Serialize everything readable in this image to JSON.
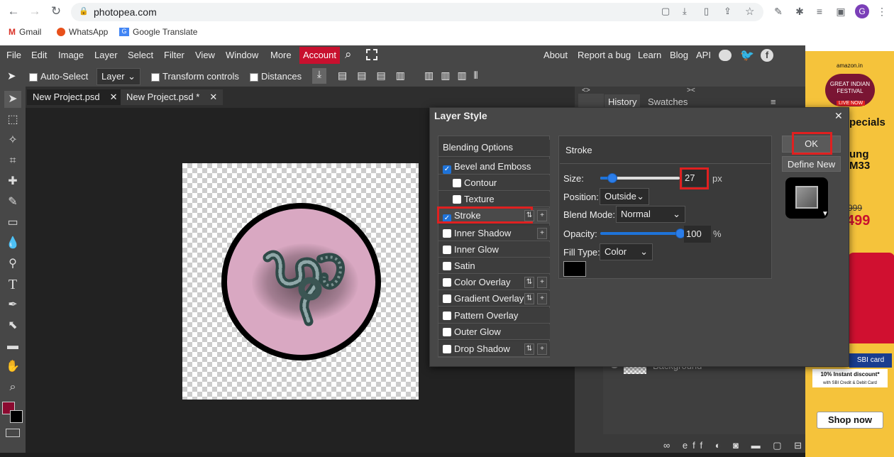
{
  "browser": {
    "url": "photopea.com",
    "bookmarks": [
      "Gmail",
      "WhatsApp",
      "Google Translate"
    ],
    "profile_initial": "G"
  },
  "menu": {
    "items": [
      "File",
      "Edit",
      "Image",
      "Layer",
      "Select",
      "Filter",
      "View",
      "Window",
      "More"
    ],
    "account": "Account",
    "right_links": [
      "About",
      "Report a bug",
      "Learn",
      "Blog",
      "API"
    ]
  },
  "toolbar": {
    "auto_select": "Auto-Select",
    "layer_select": "Layer",
    "transform_controls": "Transform controls",
    "distances": "Distances"
  },
  "tabs": [
    "New Project.psd",
    "New Project.psd *"
  ],
  "panel": {
    "history": "History",
    "swatches": "Swatches",
    "layer_name": "Background"
  },
  "dialog": {
    "title": "Layer Style",
    "options_header": "Blending Options",
    "options": [
      {
        "label": "Bevel and Emboss",
        "checked": true
      },
      {
        "label": "Contour",
        "checked": false
      },
      {
        "label": "Texture",
        "checked": false
      },
      {
        "label": "Stroke",
        "checked": true
      },
      {
        "label": "Inner Shadow",
        "checked": false
      },
      {
        "label": "Inner Glow",
        "checked": false
      },
      {
        "label": "Satin",
        "checked": false
      },
      {
        "label": "Color Overlay",
        "checked": false
      },
      {
        "label": "Gradient Overlay",
        "checked": false
      },
      {
        "label": "Pattern Overlay",
        "checked": false
      },
      {
        "label": "Outer Glow",
        "checked": false
      },
      {
        "label": "Drop Shadow",
        "checked": false
      }
    ],
    "section_title": "Stroke",
    "size_label": "Size:",
    "size_value": "27",
    "size_unit": "px",
    "position_label": "Position:",
    "position_value": "Outside",
    "blend_label": "Blend Mode:",
    "blend_value": "Normal",
    "opacity_label": "Opacity:",
    "opacity_value": "100",
    "opacity_unit": "%",
    "fill_label": "Fill Type:",
    "fill_value": "Color",
    "fill_color": "#000000",
    "ok": "OK",
    "define_new": "Define New"
  },
  "ad": {
    "brand": "amazon.in",
    "event": "GREAT INDIAN FESTIVAL",
    "live": "LIVE NOW",
    "specials": "pecials",
    "phone": "ung M33",
    "price_old": "999",
    "price_new": "499",
    "card": "SBI card",
    "discount": "10% Instant discount*",
    "discount_sub": "with SBI Credit & Debit Card",
    "cta": "Shop now"
  },
  "colors": {
    "foreground": "#8b0a30",
    "background": "#000000",
    "accent": "#1e73d9",
    "highlight": "#e02020"
  }
}
